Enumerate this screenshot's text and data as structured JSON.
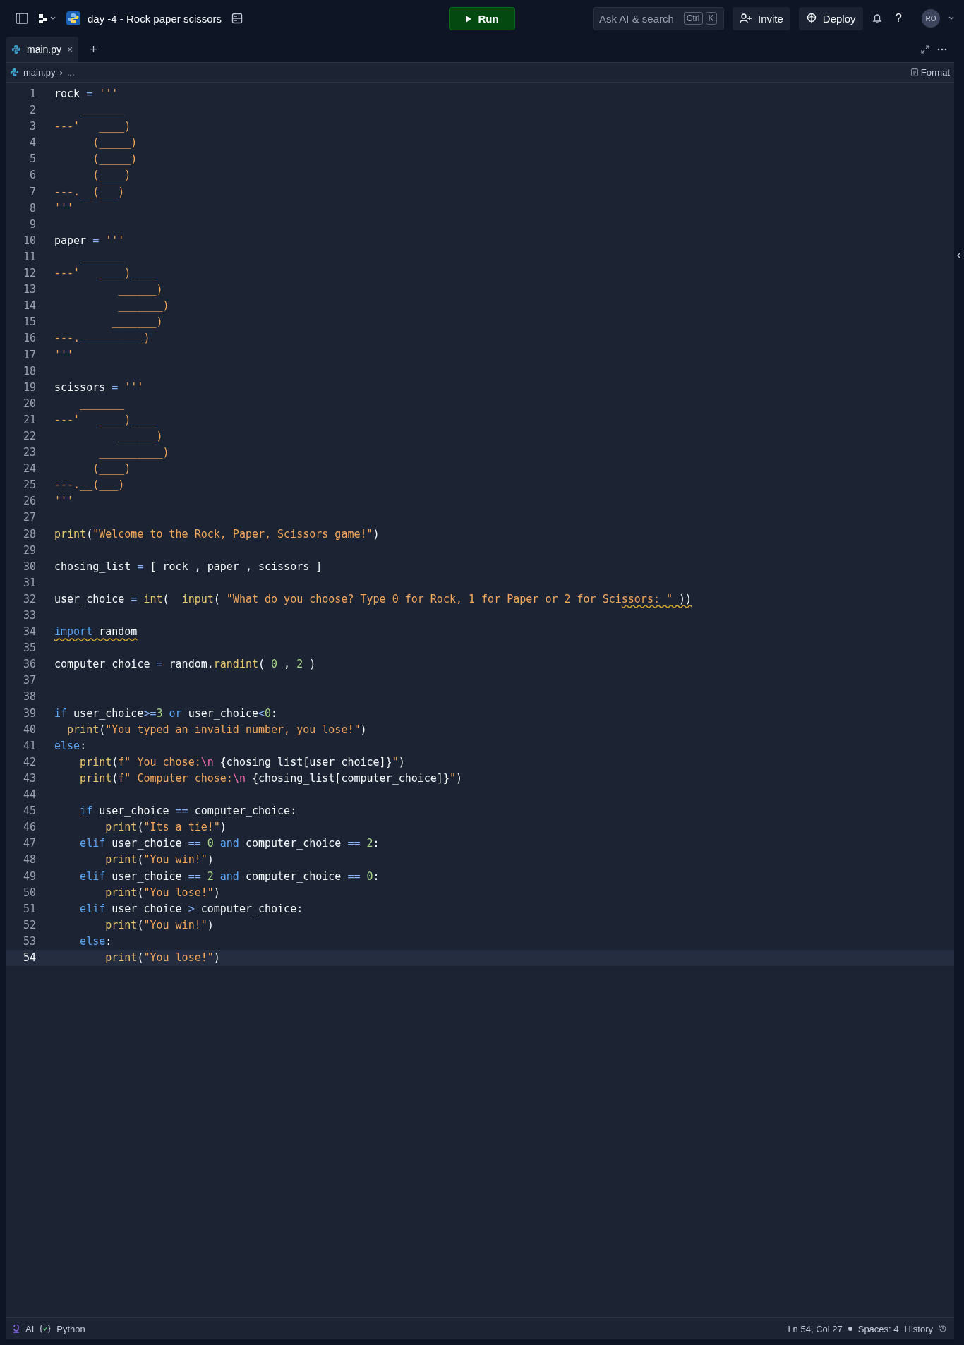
{
  "topbar": {
    "project_title": "day -4 - Rock paper scissors",
    "run_button": "Run",
    "search": {
      "placeholder": "Ask AI & search",
      "shortcut_keys": [
        "Ctrl",
        "K"
      ]
    },
    "invite_button": "Invite",
    "deploy_button": "Deploy",
    "help": "?",
    "avatar": "RO"
  },
  "tabs": [
    {
      "label": "main.py",
      "selected": true,
      "close": "×"
    }
  ],
  "new_tab": "+",
  "breadcrumb": {
    "file": "main.py",
    "separator": "›",
    "rest": "..."
  },
  "format_button": "Format",
  "code_lines": [
    {
      "number": "1",
      "current": false,
      "tokens": [
        {
          "kind": "name",
          "text": "rock"
        },
        {
          "kind": "op",
          "text": " = "
        },
        {
          "kind": "string",
          "text": "'''"
        }
      ]
    },
    {
      "number": "2",
      "current": false,
      "tokens": [
        {
          "kind": "string",
          "text": "    _______"
        }
      ]
    },
    {
      "number": "3",
      "current": false,
      "tokens": [
        {
          "kind": "string",
          "text": "---'   ____)"
        }
      ]
    },
    {
      "number": "4",
      "current": false,
      "tokens": [
        {
          "kind": "string",
          "text": "      (_____)"
        }
      ]
    },
    {
      "number": "5",
      "current": false,
      "tokens": [
        {
          "kind": "string",
          "text": "      (_____)"
        }
      ]
    },
    {
      "number": "6",
      "current": false,
      "tokens": [
        {
          "kind": "string",
          "text": "      (____)"
        }
      ]
    },
    {
      "number": "7",
      "current": false,
      "tokens": [
        {
          "kind": "string",
          "text": "---.__(___)"
        }
      ]
    },
    {
      "number": "8",
      "current": false,
      "tokens": [
        {
          "kind": "string",
          "text": "'''"
        }
      ]
    },
    {
      "number": "9",
      "current": false
    },
    {
      "number": "10",
      "current": false,
      "tokens": [
        {
          "kind": "name",
          "text": "paper"
        },
        {
          "kind": "op",
          "text": " = "
        },
        {
          "kind": "string",
          "text": "'''"
        }
      ]
    },
    {
      "number": "11",
      "current": false,
      "tokens": [
        {
          "kind": "string",
          "text": "    _______"
        }
      ]
    },
    {
      "number": "12",
      "current": false,
      "tokens": [
        {
          "kind": "string",
          "text": "---'   ____)____"
        }
      ]
    },
    {
      "number": "13",
      "current": false,
      "tokens": [
        {
          "kind": "string",
          "text": "          ______)"
        }
      ]
    },
    {
      "number": "14",
      "current": false,
      "tokens": [
        {
          "kind": "string",
          "text": "          _______)"
        }
      ]
    },
    {
      "number": "15",
      "current": false,
      "tokens": [
        {
          "kind": "string",
          "text": "         _______)"
        }
      ]
    },
    {
      "number": "16",
      "current": false,
      "tokens": [
        {
          "kind": "string",
          "text": "---.__________)"
        }
      ]
    },
    {
      "number": "17",
      "current": false,
      "tokens": [
        {
          "kind": "string",
          "text": "'''"
        }
      ]
    },
    {
      "number": "18",
      "current": false
    },
    {
      "number": "19",
      "current": false,
      "tokens": [
        {
          "kind": "name",
          "text": "scissors"
        },
        {
          "kind": "op",
          "text": " = "
        },
        {
          "kind": "string",
          "text": "'''"
        }
      ]
    },
    {
      "number": "20",
      "current": false,
      "tokens": [
        {
          "kind": "string",
          "text": "    _______"
        }
      ]
    },
    {
      "number": "21",
      "current": false,
      "tokens": [
        {
          "kind": "string",
          "text": "---'   ____)____"
        }
      ]
    },
    {
      "number": "22",
      "current": false,
      "tokens": [
        {
          "kind": "string",
          "text": "          ______)"
        }
      ]
    },
    {
      "number": "23",
      "current": false,
      "tokens": [
        {
          "kind": "string",
          "text": "       __________)"
        }
      ]
    },
    {
      "number": "24",
      "current": false,
      "tokens": [
        {
          "kind": "string",
          "text": "      (____)"
        }
      ]
    },
    {
      "number": "25",
      "current": false,
      "tokens": [
        {
          "kind": "string",
          "text": "---.__(___)"
        }
      ]
    },
    {
      "number": "26",
      "current": false,
      "tokens": [
        {
          "kind": "string",
          "text": "'''"
        }
      ]
    },
    {
      "number": "27",
      "current": false
    },
    {
      "number": "28",
      "current": false,
      "tokens": [
        {
          "kind": "func",
          "text": "print"
        },
        {
          "kind": "punct",
          "text": "("
        },
        {
          "kind": "string",
          "text": "\"Welcome to the Rock, Paper, Scissors game!\""
        },
        {
          "kind": "punct",
          "text": ")"
        }
      ]
    },
    {
      "number": "29",
      "current": false
    },
    {
      "number": "30",
      "current": false,
      "tokens": [
        {
          "kind": "name",
          "text": "chosing_list"
        },
        {
          "kind": "op",
          "text": " = "
        },
        {
          "kind": "punct",
          "text": "[ rock , paper , scissors ]"
        }
      ]
    },
    {
      "number": "31",
      "current": false
    },
    {
      "number": "32",
      "current": false,
      "tokens": [
        {
          "kind": "name",
          "text": "user_choice"
        },
        {
          "kind": "op",
          "text": " = "
        },
        {
          "kind": "func",
          "text": "int"
        },
        {
          "kind": "punct",
          "text": "(  "
        },
        {
          "kind": "func",
          "text": "input"
        },
        {
          "kind": "punct",
          "text": "( "
        },
        {
          "kind": "string",
          "text": "\"What do you choose? Type 0 for Rock, 1 for Paper or 2 for Sci"
        },
        {
          "kind": "string",
          "text": "ssors: \" ",
          "underlined": true
        },
        {
          "kind": "punct",
          "text": "))",
          "underlined": true
        }
      ]
    },
    {
      "number": "33",
      "current": false
    },
    {
      "number": "34",
      "current": false,
      "tokens": [
        {
          "kind": "keyword",
          "text": "import ",
          "underlined": true
        },
        {
          "kind": "name",
          "text": "random",
          "underlined": true
        }
      ]
    },
    {
      "number": "35",
      "current": false
    },
    {
      "number": "36",
      "current": false,
      "tokens": [
        {
          "kind": "name",
          "text": "computer_choice"
        },
        {
          "kind": "op",
          "text": " = "
        },
        {
          "kind": "name",
          "text": "random."
        },
        {
          "kind": "func",
          "text": "randint"
        },
        {
          "kind": "punct",
          "text": "( "
        },
        {
          "kind": "number",
          "text": "0"
        },
        {
          "kind": "punct",
          "text": " , "
        },
        {
          "kind": "number",
          "text": "2"
        },
        {
          "kind": "punct",
          "text": " )"
        }
      ]
    },
    {
      "number": "37",
      "current": false
    },
    {
      "number": "38",
      "current": false
    },
    {
      "number": "39",
      "current": false,
      "tokens": [
        {
          "kind": "keyword",
          "text": "if"
        },
        {
          "kind": "name",
          "text": " user_choice"
        },
        {
          "kind": "op",
          "text": ">="
        },
        {
          "kind": "number",
          "text": "3"
        },
        {
          "kind": "keyword",
          "text": " or"
        },
        {
          "kind": "name",
          "text": " user_choice"
        },
        {
          "kind": "op",
          "text": "<"
        },
        {
          "kind": "number",
          "text": "0"
        },
        {
          "kind": "punct",
          "text": ":"
        }
      ]
    },
    {
      "number": "40",
      "current": false,
      "tokens": [
        {
          "kind": "func",
          "text": "  print"
        },
        {
          "kind": "punct",
          "text": "("
        },
        {
          "kind": "string",
          "text": "\"You typed an invalid number, you lose!\""
        },
        {
          "kind": "punct",
          "text": ")"
        }
      ]
    },
    {
      "number": "41",
      "current": false,
      "tokens": [
        {
          "kind": "keyword",
          "text": "else"
        },
        {
          "kind": "punct",
          "text": ":"
        }
      ]
    },
    {
      "number": "42",
      "current": false,
      "tokens": [
        {
          "kind": "func",
          "text": "    print"
        },
        {
          "kind": "punct",
          "text": "("
        },
        {
          "kind": "string",
          "text": "f\" You chose:"
        },
        {
          "kind": "escape",
          "text": "\\n"
        },
        {
          "kind": "name",
          "text": " {chosing_list[user_choice]}"
        },
        {
          "kind": "string",
          "text": "\""
        },
        {
          "kind": "punct",
          "text": ")"
        }
      ]
    },
    {
      "number": "43",
      "current": false,
      "tokens": [
        {
          "kind": "func",
          "text": "    print"
        },
        {
          "kind": "punct",
          "text": "("
        },
        {
          "kind": "string",
          "text": "f\" Computer chose:"
        },
        {
          "kind": "escape",
          "text": "\\n"
        },
        {
          "kind": "name",
          "text": " {chosing_list[computer_choice]}"
        },
        {
          "kind": "string",
          "text": "\""
        },
        {
          "kind": "punct",
          "text": ")"
        }
      ]
    },
    {
      "number": "44",
      "current": false
    },
    {
      "number": "45",
      "current": false,
      "tokens": [
        {
          "kind": "keyword",
          "text": "    if"
        },
        {
          "kind": "name",
          "text": " user_choice "
        },
        {
          "kind": "op",
          "text": "=="
        },
        {
          "kind": "name",
          "text": " computer_choice"
        },
        {
          "kind": "punct",
          "text": ":"
        }
      ]
    },
    {
      "number": "46",
      "current": false,
      "tokens": [
        {
          "kind": "func",
          "text": "        print"
        },
        {
          "kind": "punct",
          "text": "("
        },
        {
          "kind": "string",
          "text": "\"Its a tie!\""
        },
        {
          "kind": "punct",
          "text": ")"
        }
      ]
    },
    {
      "number": "47",
      "current": false,
      "tokens": [
        {
          "kind": "keyword",
          "text": "    elif"
        },
        {
          "kind": "name",
          "text": " user_choice "
        },
        {
          "kind": "op",
          "text": "== "
        },
        {
          "kind": "number",
          "text": "0"
        },
        {
          "kind": "keyword",
          "text": " and"
        },
        {
          "kind": "name",
          "text": " computer_choice "
        },
        {
          "kind": "op",
          "text": "== "
        },
        {
          "kind": "number",
          "text": "2"
        },
        {
          "kind": "punct",
          "text": ":"
        }
      ]
    },
    {
      "number": "48",
      "current": false,
      "tokens": [
        {
          "kind": "func",
          "text": "        print"
        },
        {
          "kind": "punct",
          "text": "("
        },
        {
          "kind": "string",
          "text": "\"You win!\""
        },
        {
          "kind": "punct",
          "text": ")"
        }
      ]
    },
    {
      "number": "49",
      "current": false,
      "tokens": [
        {
          "kind": "keyword",
          "text": "    elif"
        },
        {
          "kind": "name",
          "text": " user_choice "
        },
        {
          "kind": "op",
          "text": "== "
        },
        {
          "kind": "number",
          "text": "2"
        },
        {
          "kind": "keyword",
          "text": " and"
        },
        {
          "kind": "name",
          "text": " computer_choice "
        },
        {
          "kind": "op",
          "text": "== "
        },
        {
          "kind": "number",
          "text": "0"
        },
        {
          "kind": "punct",
          "text": ":"
        }
      ]
    },
    {
      "number": "50",
      "current": false,
      "tokens": [
        {
          "kind": "func",
          "text": "        print"
        },
        {
          "kind": "punct",
          "text": "("
        },
        {
          "kind": "string",
          "text": "\"You lose!\""
        },
        {
          "kind": "punct",
          "text": ")"
        }
      ]
    },
    {
      "number": "51",
      "current": false,
      "tokens": [
        {
          "kind": "keyword",
          "text": "    elif"
        },
        {
          "kind": "name",
          "text": " user_choice "
        },
        {
          "kind": "op",
          "text": ">"
        },
        {
          "kind": "name",
          "text": " computer_choice"
        },
        {
          "kind": "punct",
          "text": ":"
        }
      ]
    },
    {
      "number": "52",
      "current": false,
      "tokens": [
        {
          "kind": "func",
          "text": "        print"
        },
        {
          "kind": "punct",
          "text": "("
        },
        {
          "kind": "string",
          "text": "\"You win!\""
        },
        {
          "kind": "punct",
          "text": ")"
        }
      ]
    },
    {
      "number": "53",
      "current": false,
      "tokens": [
        {
          "kind": "keyword",
          "text": "    else"
        },
        {
          "kind": "punct",
          "text": ":"
        }
      ]
    },
    {
      "number": "54",
      "current": true,
      "tokens": [
        {
          "kind": "func",
          "text": "        print"
        },
        {
          "kind": "punct",
          "text": "("
        },
        {
          "kind": "string",
          "text": "\"You lose!\""
        },
        {
          "kind": "punct",
          "text": ")"
        }
      ]
    }
  ],
  "status_bar": {
    "ai": "AI",
    "language": "Python",
    "cursor": "Ln 54, Col 27",
    "indent": "Spaces: 4",
    "history": "History"
  }
}
